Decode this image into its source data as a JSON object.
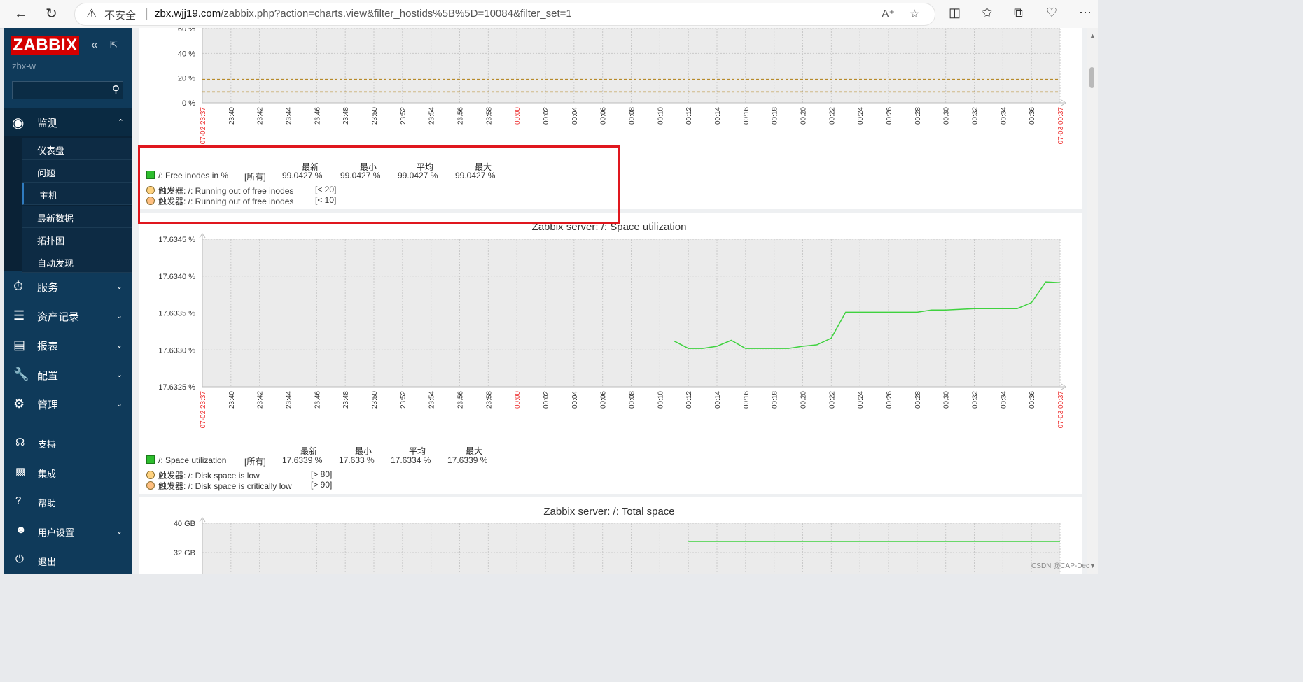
{
  "browser": {
    "security": "不安全",
    "url_host": "zbx.wjj19.com",
    "url_rest": "/zabbix.php?action=charts.view&filter_hostids%5B%5D=10084&filter_set=1",
    "read_aloud": "Á"
  },
  "sidebar": {
    "logo": "ZABBIX",
    "server": "zbx-w",
    "monitoring": "监测",
    "submenu": [
      "仪表盘",
      "问题",
      "主机",
      "最新数据",
      "拓扑图",
      "自动发现"
    ],
    "menus": [
      "服务",
      "资产记录",
      "报表",
      "配置",
      "管理"
    ],
    "bottom": [
      "支持",
      "集成",
      "帮助",
      "用户设置",
      "退出"
    ]
  },
  "charts": {
    "time_labels": [
      "23:37",
      "23:40",
      "23:42",
      "23:44",
      "23:46",
      "23:48",
      "23:50",
      "23:52",
      "23:54",
      "23:56",
      "23:58",
      "00:00",
      "00:02",
      "00:04",
      "00:06",
      "00:08",
      "00:10",
      "00:12",
      "00:14",
      "00:16",
      "00:18",
      "00:20",
      "00:22",
      "00:24",
      "00:26",
      "00:28",
      "00:30",
      "00:32",
      "00:34",
      "00:36",
      "00:37"
    ],
    "date_start": "07-02 23:37",
    "date_end": "07-03 00:37",
    "midnight": "00:00",
    "inodes": {
      "y_ticks": [
        "60 %",
        "40 %",
        "20 %",
        "0 %"
      ],
      "legend_head": [
        "最新",
        "最小",
        "平均",
        "最大"
      ],
      "item": "/: Free inodes in %",
      "all": "[所有]",
      "values": [
        "99.0427 %",
        "99.0427 %",
        "99.0427 %",
        "99.0427 %"
      ],
      "triggers": [
        {
          "label": "触发器: /: Running out of free inodes",
          "cond": "[< 20]"
        },
        {
          "label": "触发器: /: Running out of free inodes",
          "cond": "[< 10]"
        }
      ]
    },
    "space": {
      "title": "Zabbix server: /: Space utilization",
      "y_ticks": [
        "17.6345 %",
        "17.6340 %",
        "17.6335 %",
        "17.6330 %",
        "17.6325 %"
      ],
      "legend_head": [
        "最新",
        "最小",
        "平均",
        "最大"
      ],
      "item": "/: Space utilization",
      "all": "[所有]",
      "values": [
        "17.6339 %",
        "17.633 %",
        "17.6334 %",
        "17.6339 %"
      ],
      "triggers": [
        {
          "label": "触发器: /: Disk space is low",
          "cond": "[> 80]"
        },
        {
          "label": "触发器: /: Disk space is critically low",
          "cond": "[> 90]"
        }
      ]
    },
    "total": {
      "title": "Zabbix server: /: Total space",
      "y_ticks": [
        "40 GB",
        "32 GB"
      ]
    }
  },
  "chart_data": [
    {
      "type": "line",
      "title": "",
      "ylim": [
        0,
        100
      ],
      "series": [
        {
          "name": "/: Free inodes in %",
          "values": []
        }
      ],
      "thresholds": [
        20,
        10
      ]
    },
    {
      "type": "line",
      "title": "Zabbix server: /: Space utilization",
      "ylim": [
        17.6325,
        17.6345
      ],
      "x": [
        "00:10",
        "00:11",
        "00:12",
        "00:13",
        "00:14",
        "00:15",
        "00:16",
        "00:17",
        "00:18",
        "00:19",
        "00:20",
        "00:21",
        "00:22",
        "00:23",
        "00:24",
        "00:25",
        "00:26",
        "00:27",
        "00:28",
        "00:29",
        "00:30",
        "00:31",
        "00:32",
        "00:33",
        "00:34",
        "00:35",
        "00:36",
        "00:37"
      ],
      "series": [
        {
          "name": "/: Space utilization",
          "values": [
            17.63312,
            17.63302,
            17.63302,
            17.63305,
            17.63313,
            17.63302,
            17.63302,
            17.63302,
            17.63302,
            17.63305,
            17.63307,
            17.63316,
            17.63351,
            17.63351,
            17.63351,
            17.63351,
            17.63351,
            17.63351,
            17.63354,
            17.63354,
            17.63355,
            17.63356,
            17.63356,
            17.63356,
            17.63356,
            17.63364,
            17.63392,
            17.63391
          ]
        }
      ]
    },
    {
      "type": "line",
      "title": "Zabbix server: /: Total space",
      "series": [
        {
          "name": "",
          "values": []
        }
      ]
    }
  ],
  "watermark": "CSDN @CAP-Dec"
}
